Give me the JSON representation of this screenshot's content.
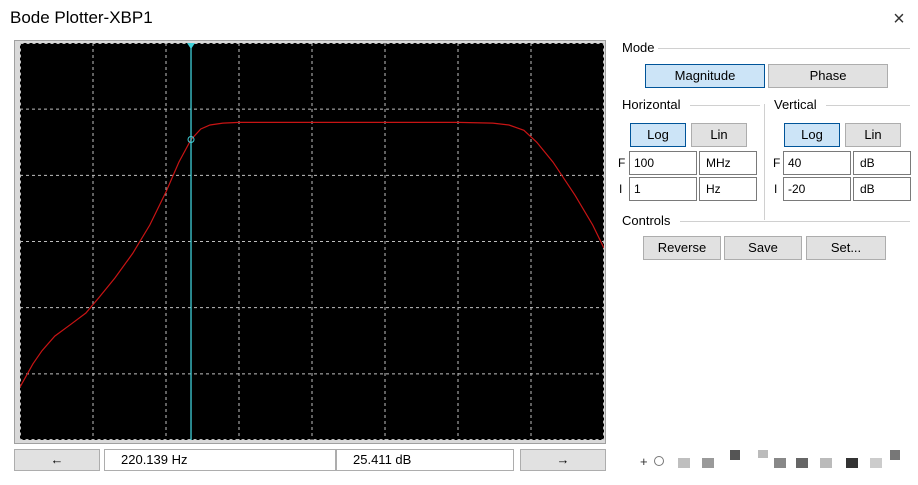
{
  "window": {
    "title": "Bode Plotter-XBP1",
    "close_icon": "×"
  },
  "mode": {
    "label": "Mode",
    "magnitude_label": "Magnitude",
    "phase_label": "Phase",
    "selected": "Magnitude"
  },
  "horizontal": {
    "label": "Horizontal",
    "log_label": "Log",
    "lin_label": "Lin",
    "selected": "Log",
    "f_letter": "F",
    "i_letter": "I",
    "f_value": "100",
    "f_unit": "MHz",
    "i_value": "1",
    "i_unit": "Hz"
  },
  "vertical": {
    "label": "Vertical",
    "log_label": "Log",
    "lin_label": "Lin",
    "selected": "Log",
    "f_letter": "F",
    "i_letter": "I",
    "f_value": "40",
    "f_unit": "dB",
    "i_value": "-20",
    "i_unit": "dB"
  },
  "controls": {
    "label": "Controls",
    "reverse_label": "Reverse",
    "save_label": "Save",
    "set_label": "Set..."
  },
  "status": {
    "left_arrow": "←",
    "right_arrow": "→",
    "frequency_readout": "220.139 Hz",
    "magnitude_readout": "25.411 dB"
  },
  "terminals": {
    "plus_label": "+"
  },
  "colors": {
    "plot_background": "#000000",
    "trace": "#c81414",
    "cursor": "#3fd0d8",
    "grid": "#bfbfbf",
    "active_button": "#cce4f7"
  },
  "chart_data": {
    "type": "line",
    "x_axis": {
      "min": 1,
      "max": 100000000,
      "unit": "Hz",
      "scale": "log"
    },
    "y_axis": {
      "min": -20,
      "max": 40,
      "unit": "dB"
    },
    "grid": true,
    "cursor": {
      "frequency": 220.139,
      "magnitude": 25.411
    },
    "series": [
      {
        "x": [
          1,
          1.5,
          2,
          3,
          5,
          8,
          12,
          20,
          35,
          60,
          100,
          150,
          220.139,
          300,
          400,
          600,
          1000,
          10000,
          100000,
          1000000,
          3000000,
          5000000,
          8000000,
          12000000,
          20000000,
          40000000,
          70000000,
          100000000
        ],
        "y": [
          -12,
          -8.5,
          -6.5,
          -4.3,
          -2.5,
          -0.8,
          1.5,
          4.5,
          8.2,
          12.5,
          17.5,
          22.0,
          25.4,
          27.0,
          27.6,
          27.9,
          28.0,
          28.0,
          28.0,
          28.0,
          27.9,
          27.6,
          26.8,
          25.0,
          22.0,
          17.0,
          12.5,
          9.0
        ]
      }
    ]
  }
}
